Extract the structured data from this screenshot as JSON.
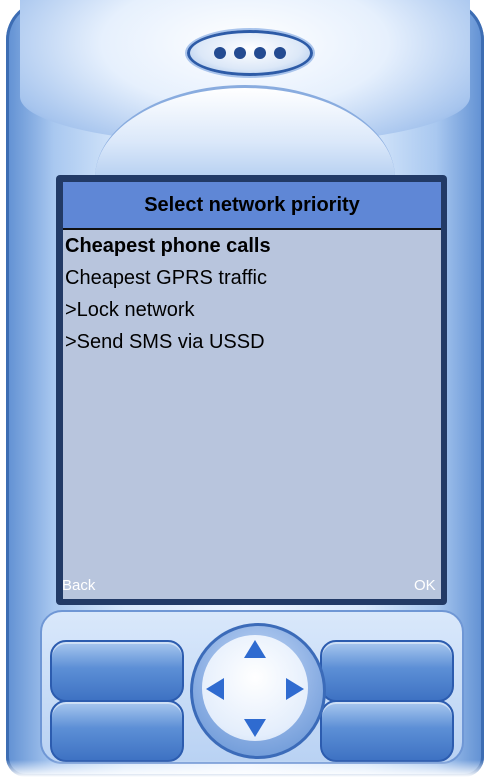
{
  "screen": {
    "title": "Select network priority",
    "menu_items": [
      {
        "label": "Cheapest phone calls",
        "selected": true
      },
      {
        "label": "Cheapest GPRS traffic",
        "selected": false
      },
      {
        "label": ">Lock network",
        "selected": false
      },
      {
        "label": ">Send SMS via USSD",
        "selected": false
      }
    ],
    "softkeys": {
      "left": "Back",
      "right": "OK"
    }
  },
  "colors": {
    "screen_bg": "#b8c5dd",
    "title_bg": "#5f87d6",
    "phone_blue": "#3e72c3",
    "arrow_blue": "#2f6bd0"
  },
  "icons": {
    "speaker": "speaker-grille-icon",
    "dpad_up": "arrow-up-icon",
    "dpad_down": "arrow-down-icon",
    "dpad_left": "arrow-left-icon",
    "dpad_right": "arrow-right-icon"
  }
}
